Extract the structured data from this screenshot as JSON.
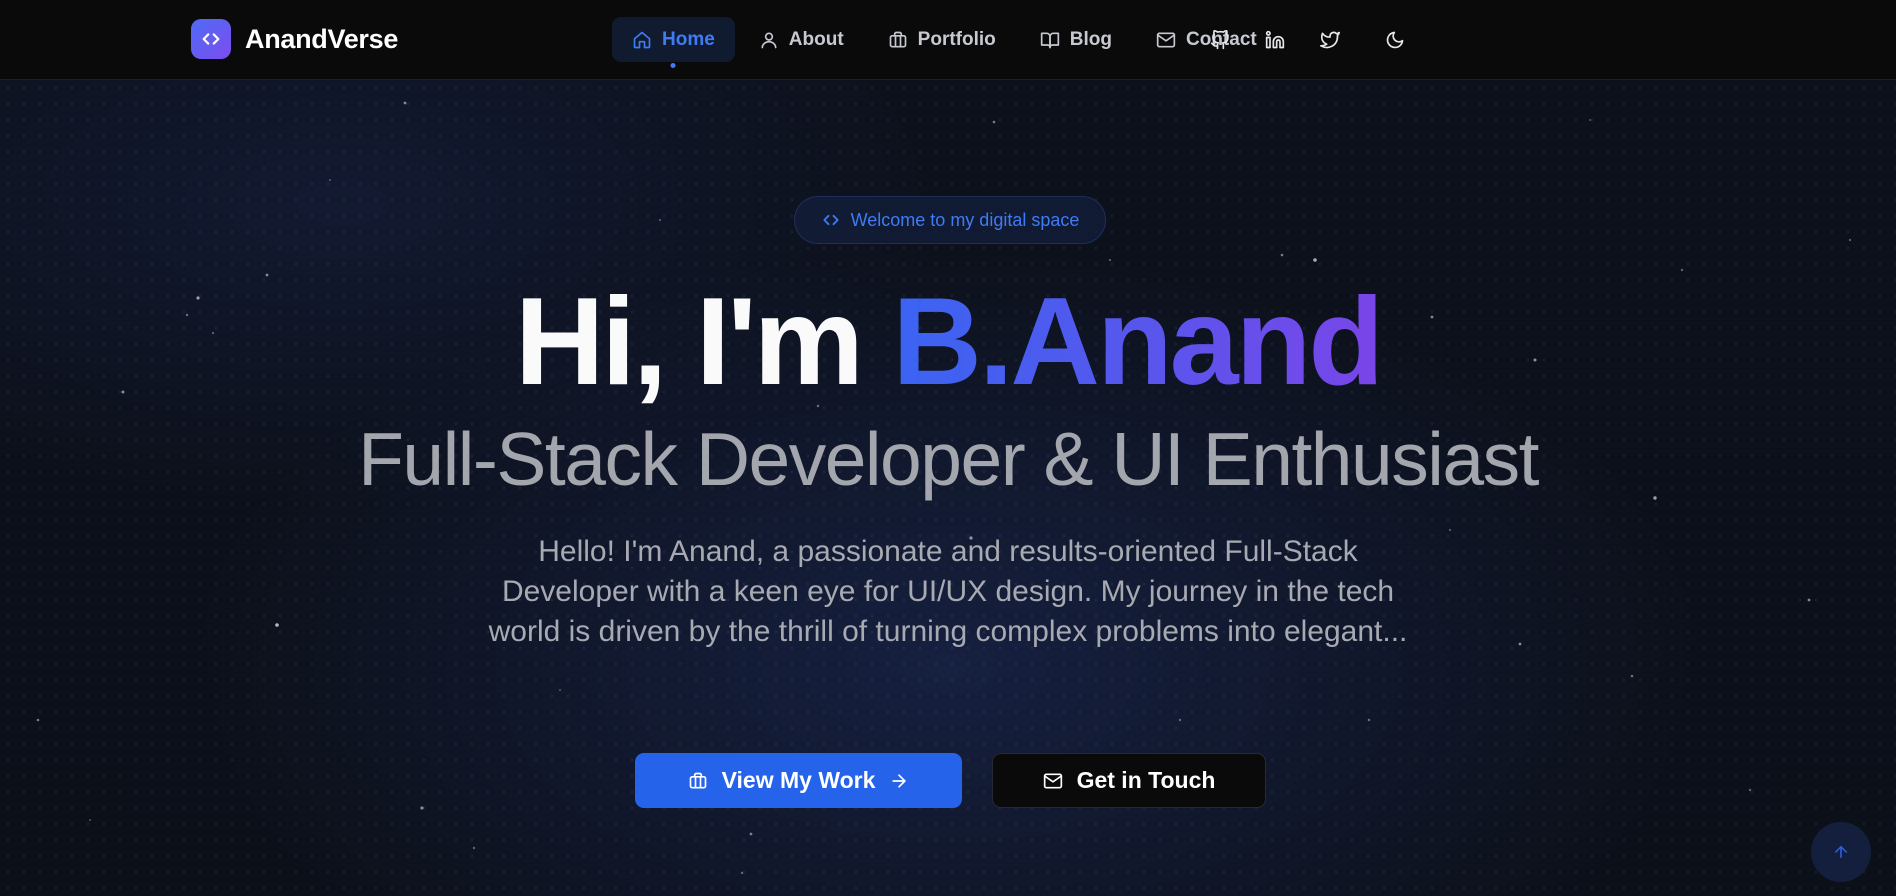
{
  "brand": {
    "name": "AnandVerse",
    "logo_icon": "code-brackets-icon",
    "gradient": [
      "#4f6bf6",
      "#7c4dee"
    ]
  },
  "nav": {
    "items": [
      {
        "label": "Home",
        "icon": "home-icon",
        "active": true
      },
      {
        "label": "About",
        "icon": "user-icon",
        "active": false
      },
      {
        "label": "Portfolio",
        "icon": "briefcase-icon",
        "active": false
      },
      {
        "label": "Blog",
        "icon": "book-open-icon",
        "active": false
      },
      {
        "label": "Contact",
        "icon": "mail-icon",
        "active": false
      }
    ],
    "social_icons": [
      "github-icon",
      "linkedin-icon",
      "twitter-icon"
    ],
    "theme_icon": "moon-icon"
  },
  "hero": {
    "welcome": "Welcome to my digital space",
    "greeting": "Hi, I'm ",
    "name": "B.Anand",
    "subtitle": "Full-Stack Developer & UI Enthusiast",
    "intro": "Hello! I'm Anand, a passionate and results-oriented Full-Stack Developer with a keen eye for UI/UX design. My journey in the tech world is driven by the thrill of turning complex problems into elegant...",
    "primary_button": "View My Work",
    "secondary_button": "Get in Touch"
  },
  "scroll_top_icon": "arrow-up-icon",
  "colors": {
    "accent": "#2563eb",
    "nav_active": "#3f7bf5",
    "background": "#0b0c10"
  }
}
